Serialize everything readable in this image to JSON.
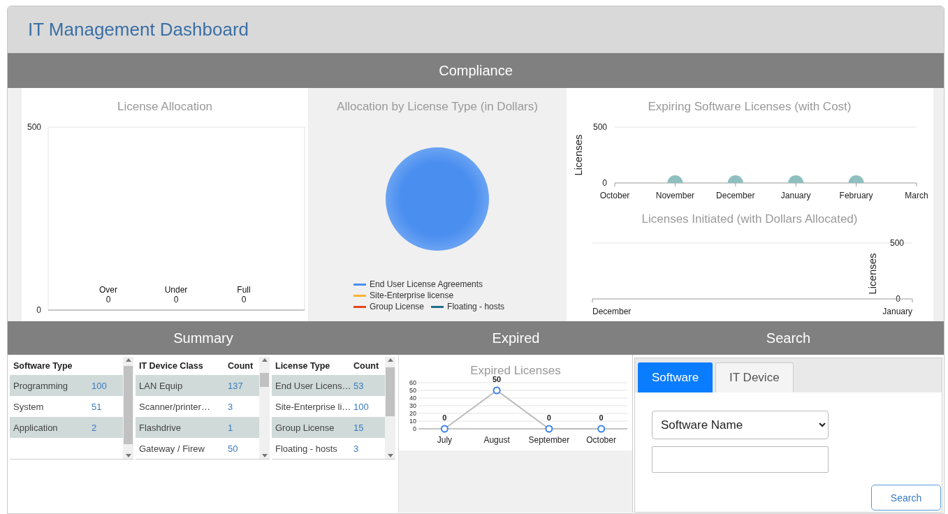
{
  "header": {
    "title": "IT Management Dashboard"
  },
  "compliance": {
    "title": "Compliance",
    "license_allocation": {
      "chart_data": {
        "type": "bar",
        "title": "License Allocation",
        "categories": [
          "Over",
          "Under",
          "Full"
        ],
        "values": [
          0,
          0,
          0
        ],
        "ylim": [
          0,
          500
        ],
        "yticks": [
          0,
          500
        ],
        "data_labels": true
      }
    },
    "allocation_by_type": {
      "title": "Allocation by License Type (in Dollars)",
      "legend": [
        {
          "label": "End User License Agreements",
          "color": "#4a8ef0"
        },
        {
          "label": "Site-Enterprise license",
          "color": "#f5b335"
        },
        {
          "label": "Group License",
          "color": "#e5461f"
        },
        {
          "label": "Floating - hosts",
          "color": "#1f6e8c"
        }
      ]
    },
    "expiring": {
      "chart_data": {
        "type": "scatter",
        "title": "Expiring Software Licenses (with Cost)",
        "ylabel": "Licenses",
        "categories": [
          "October",
          "November",
          "December",
          "January",
          "February",
          "March"
        ],
        "values": [
          null,
          0,
          0,
          0,
          0,
          null
        ],
        "ylim": [
          0,
          500
        ],
        "yticks": [
          0,
          500
        ]
      }
    },
    "initiated": {
      "chart_data": {
        "type": "line",
        "title": "Licenses Initiated (with Dollars Allocated)",
        "ylabel": "Licenses",
        "categories": [
          "December",
          "January"
        ],
        "values": [
          null,
          null
        ],
        "ylim": [
          0,
          500
        ],
        "yticks": [
          0,
          500
        ]
      }
    }
  },
  "summary": {
    "title": "Summary",
    "tables": [
      {
        "columns": [
          "Software Type",
          null
        ],
        "rows": [
          [
            "Programming",
            "100"
          ],
          [
            "System",
            "51"
          ],
          [
            "Application",
            "2"
          ],
          [
            "",
            ""
          ]
        ]
      },
      {
        "columns": [
          "IT Device Class",
          "Count"
        ],
        "rows": [
          [
            "LAN Equip",
            "137"
          ],
          [
            "Scanner/printer…",
            "3"
          ],
          [
            "Flashdrive",
            "1"
          ],
          [
            "Gateway / Firew",
            "50"
          ]
        ]
      },
      {
        "columns": [
          "License Type",
          "Count"
        ],
        "rows": [
          [
            "End User Licens…",
            "53"
          ],
          [
            "Site-Enterprise li…",
            "100"
          ],
          [
            "Group License",
            "15"
          ],
          [
            "Floating - hosts",
            "3"
          ]
        ]
      }
    ]
  },
  "expired": {
    "title": "Expired",
    "chart_data": {
      "type": "line",
      "title": "Expired Licenses",
      "categories": [
        "July",
        "August",
        "September",
        "October"
      ],
      "values": [
        0,
        50,
        0,
        0
      ],
      "ylim": [
        0,
        60
      ],
      "yticks": [
        0,
        10,
        20,
        30,
        40,
        50,
        60
      ],
      "data_labels": true,
      "grid": true,
      "marker": "circle"
    }
  },
  "search": {
    "title": "Search",
    "tabs": [
      {
        "label": "Software",
        "selected": true
      },
      {
        "label": "IT Device",
        "selected": false
      }
    ],
    "select": {
      "value": "Software Name"
    },
    "button": "Search"
  }
}
